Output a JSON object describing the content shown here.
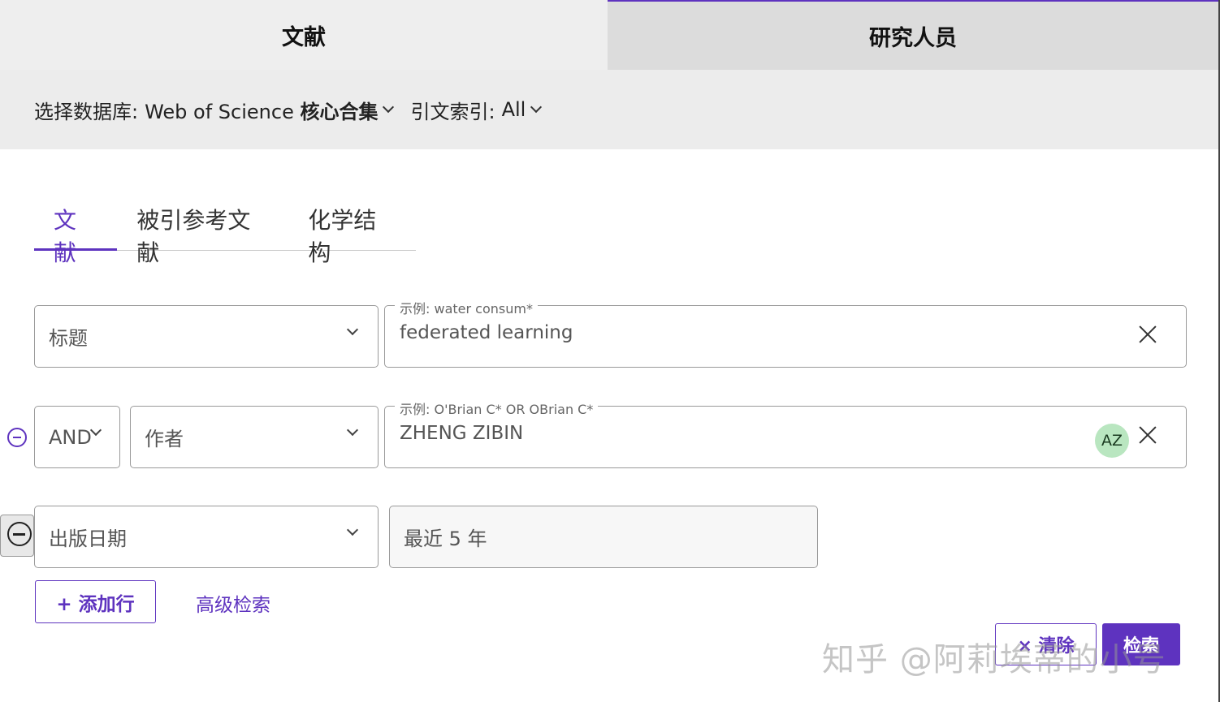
{
  "top_tabs": {
    "documents": "文献",
    "researchers": "研究人员"
  },
  "database_bar": {
    "db_label": "选择数据库:",
    "db_value_prefix": "Web of Science",
    "db_value_bold": "核心合集",
    "index_label": "引文索引:",
    "index_value": "All"
  },
  "sub_tabs": [
    "文献",
    "被引参考文献",
    "化学结构"
  ],
  "rows": [
    {
      "field": "标题",
      "legend": "示例: water consum*",
      "value": "federated learning"
    },
    {
      "operator": "AND",
      "field": "作者",
      "legend": "示例: O'Brian C* OR OBrian C*",
      "value": "ZHENG ZIBIN",
      "az_icon": "AZ"
    },
    {
      "field": "出版日期",
      "value": "最近 5 年"
    }
  ],
  "actions": {
    "add_row": "+ 添加行",
    "advanced": "高级检索",
    "clear": "× 清除",
    "search": "检索"
  },
  "watermark": "知乎 @阿莉埃蒂的小号",
  "colors": {
    "accent": "#5e33bf",
    "tab_bg": "#eeeeee",
    "az_bg": "#b9e6c0"
  }
}
